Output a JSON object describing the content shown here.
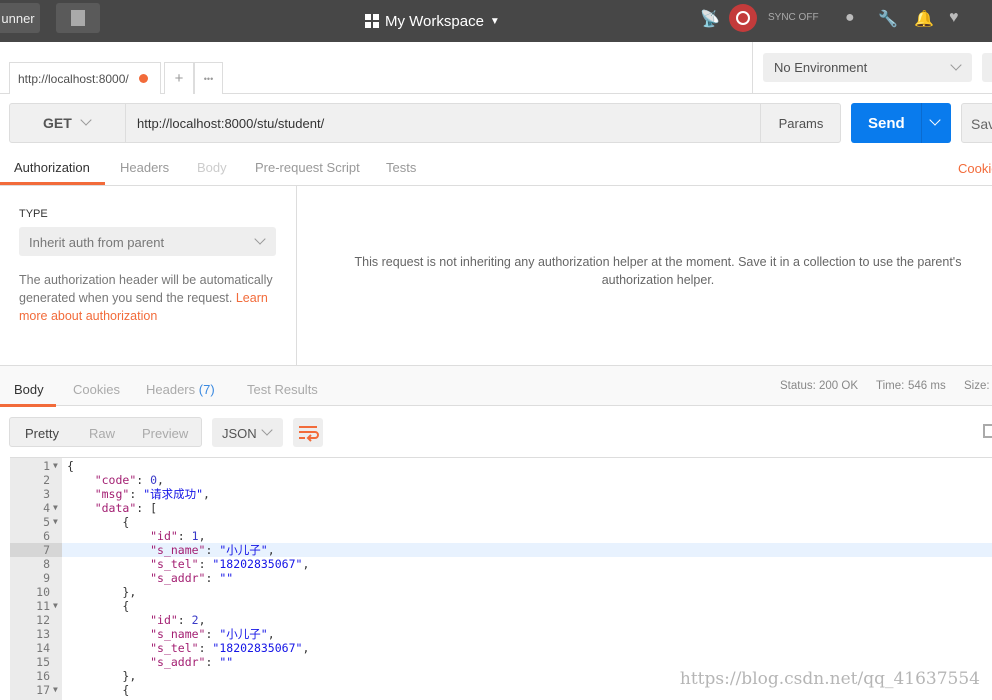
{
  "topbar": {
    "runner_label": "unner",
    "workspace": "My Workspace",
    "sync": "SYNC OFF",
    "icons": [
      "satellite-icon",
      "sync-icon",
      "globe-icon",
      "wrench-icon",
      "bell-icon",
      "heart-icon"
    ]
  },
  "tabs": {
    "active": "http://localhost:8000/",
    "new": "+",
    "more": "•••",
    "environment": "No Environment"
  },
  "request": {
    "method": "GET",
    "url": "http://localhost:8000/stu/student/",
    "params": "Params",
    "send": "Send",
    "save": "Sav"
  },
  "subtabs": [
    "Authorization",
    "Headers",
    "Body",
    "Pre-request Script",
    "Tests"
  ],
  "cookies_link": "Cookie",
  "auth": {
    "type_label": "TYPE",
    "type_value": "Inherit auth from parent",
    "desc": "The authorization header will be automatically generated when you send the request.",
    "learn": "Learn more about authorization",
    "message": "This request is not inheriting any authorization helper at the moment. Save it in a collection to use the parent's authorization helper."
  },
  "response": {
    "tabs": [
      "Body",
      "Cookies",
      "Headers",
      "Test Results"
    ],
    "headers_count": "(7)",
    "status_label": "Status:",
    "status": "200 OK",
    "time_label": "Time:",
    "time": "546 ms",
    "size_label": "Size:",
    "views": [
      "Pretty",
      "Raw",
      "Preview"
    ],
    "format": "JSON"
  },
  "colors": {
    "accent": "#f26b3a",
    "send": "#097bed",
    "topbar": "#474747"
  },
  "editor": {
    "highlight_line": 7,
    "lines": [
      {
        "n": "1",
        "fold": true,
        "indent": 0,
        "t": [
          [
            "p",
            "{"
          ]
        ]
      },
      {
        "n": "2",
        "indent": 1,
        "t": [
          [
            "k",
            "\"code\""
          ],
          [
            "p",
            ": "
          ],
          [
            "n",
            "0"
          ],
          [
            "p",
            ","
          ]
        ]
      },
      {
        "n": "3",
        "indent": 1,
        "t": [
          [
            "k",
            "\"msg\""
          ],
          [
            "p",
            ": "
          ],
          [
            "s",
            "\"请求成功\""
          ],
          [
            "p",
            ","
          ]
        ]
      },
      {
        "n": "4",
        "fold": true,
        "indent": 1,
        "t": [
          [
            "k",
            "\"data\""
          ],
          [
            "p",
            ": ["
          ]
        ]
      },
      {
        "n": "5",
        "fold": true,
        "indent": 2,
        "t": [
          [
            "p",
            "{"
          ]
        ]
      },
      {
        "n": "6",
        "indent": 3,
        "t": [
          [
            "k",
            "\"id\""
          ],
          [
            "p",
            ": "
          ],
          [
            "n",
            "1"
          ],
          [
            "p",
            ","
          ]
        ]
      },
      {
        "n": "7",
        "indent": 3,
        "t": [
          [
            "k",
            "\"s_name\""
          ],
          [
            "p",
            ": "
          ],
          [
            "s",
            "\"小儿子\""
          ],
          [
            "p",
            ","
          ]
        ]
      },
      {
        "n": "8",
        "indent": 3,
        "t": [
          [
            "k",
            "\"s_tel\""
          ],
          [
            "p",
            ": "
          ],
          [
            "s",
            "\"18202835067\""
          ],
          [
            "p",
            ","
          ]
        ]
      },
      {
        "n": "9",
        "indent": 3,
        "t": [
          [
            "k",
            "\"s_addr\""
          ],
          [
            "p",
            ": "
          ],
          [
            "s",
            "\"\""
          ]
        ]
      },
      {
        "n": "10",
        "indent": 2,
        "t": [
          [
            "p",
            "},"
          ]
        ]
      },
      {
        "n": "11",
        "fold": true,
        "indent": 2,
        "t": [
          [
            "p",
            "{"
          ]
        ]
      },
      {
        "n": "12",
        "indent": 3,
        "t": [
          [
            "k",
            "\"id\""
          ],
          [
            "p",
            ": "
          ],
          [
            "n",
            "2"
          ],
          [
            "p",
            ","
          ]
        ]
      },
      {
        "n": "13",
        "indent": 3,
        "t": [
          [
            "k",
            "\"s_name\""
          ],
          [
            "p",
            ": "
          ],
          [
            "s",
            "\"小儿子\""
          ],
          [
            "p",
            ","
          ]
        ]
      },
      {
        "n": "14",
        "indent": 3,
        "t": [
          [
            "k",
            "\"s_tel\""
          ],
          [
            "p",
            ": "
          ],
          [
            "s",
            "\"18202835067\""
          ],
          [
            "p",
            ","
          ]
        ]
      },
      {
        "n": "15",
        "indent": 3,
        "t": [
          [
            "k",
            "\"s_addr\""
          ],
          [
            "p",
            ": "
          ],
          [
            "s",
            "\"\""
          ]
        ]
      },
      {
        "n": "16",
        "indent": 2,
        "t": [
          [
            "p",
            "},"
          ]
        ]
      },
      {
        "n": "17",
        "fold": true,
        "indent": 2,
        "t": [
          [
            "p",
            "{"
          ]
        ]
      }
    ]
  },
  "watermark": "https://blog.csdn.net/qq_41637554"
}
